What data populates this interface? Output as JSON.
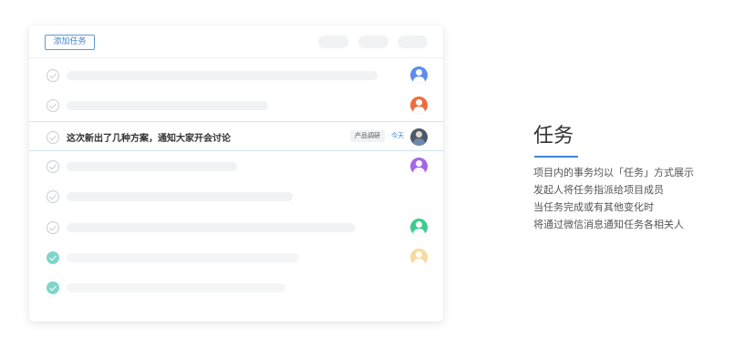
{
  "toolbar": {
    "add_task_label": "添加任务"
  },
  "active_task": {
    "title": "这次新出了几种方案，通知大家开会讨论",
    "tag": "产品调研",
    "due": "今天"
  },
  "avatars": {
    "row1": "#5b8def",
    "row2": "#ee6d3c",
    "row4": "#a467e8",
    "row6": "#3dcc8e",
    "row7": "#f7da9c"
  },
  "feature": {
    "title": "任务",
    "lines": [
      "项目内的事务均以「任务」方式展示",
      "发起人将任务指派给项目成员",
      "当任务完成或有其他变化时",
      "将通过微信消息通知任务各相关人"
    ]
  },
  "colors": {
    "accent": "#3f86cf",
    "done_check": "#7fd6c8"
  }
}
